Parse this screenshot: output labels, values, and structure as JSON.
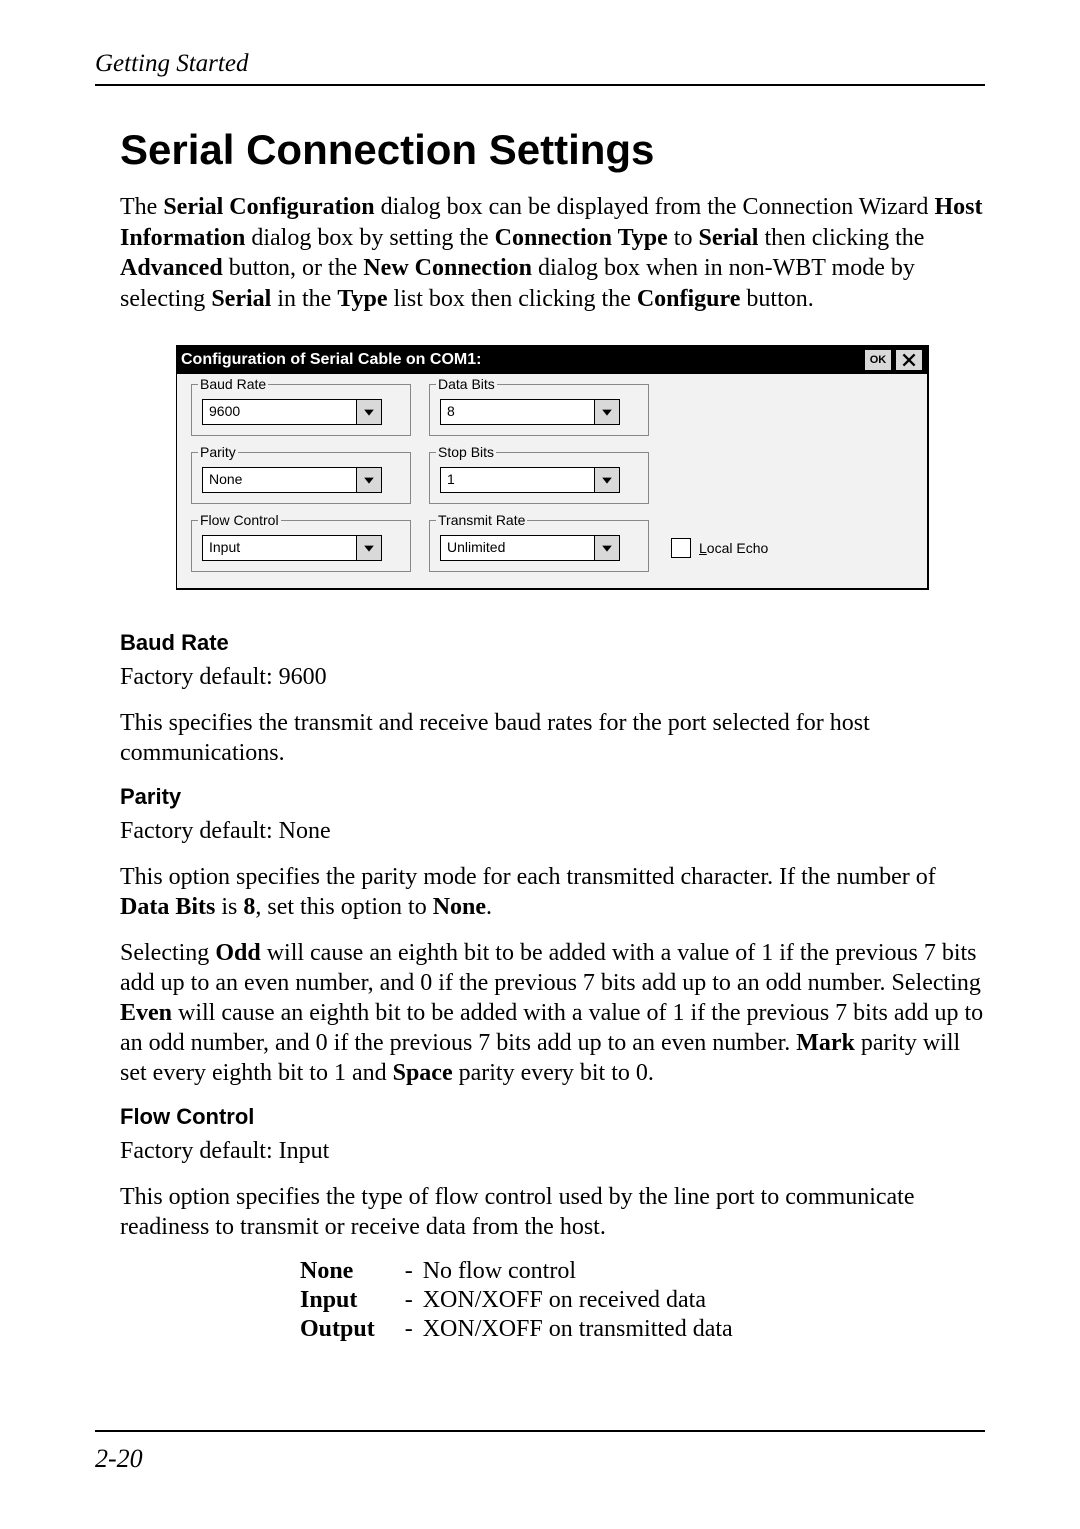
{
  "page": {
    "running_head": "Getting Started",
    "page_number": "2-20",
    "title": "Serial Connection Settings"
  },
  "intro": {
    "p1_a": "The ",
    "p1_b": "Serial Configuration",
    "p1_c": " dialog box can be displayed from the Connection Wizard ",
    "p1_d": "Host Information",
    "p1_e": " dialog box by setting the ",
    "p1_f": "Connection Type",
    "p1_g": " to ",
    "p1_h": "Serial",
    "p1_i": " then clicking the ",
    "p1_j": "Advanced",
    "p1_k": " button, or the ",
    "p1_l": "New Connection",
    "p1_m": " dialog box when in non-WBT mode by selecting ",
    "p1_n": "Serial",
    "p1_o": " in the ",
    "p1_p": "Type",
    "p1_q": " list box then clicking the ",
    "p1_r": "Configure",
    "p1_s": " button."
  },
  "dialog": {
    "title": "Configuration of Serial Cable on COM1:",
    "ok_label": "OK",
    "groups": {
      "baud_rate": {
        "legend": "Baud Rate",
        "value": "9600"
      },
      "data_bits": {
        "legend": "Data Bits",
        "value": "8"
      },
      "parity": {
        "legend": "Parity",
        "value": "None"
      },
      "stop_bits": {
        "legend": "Stop Bits",
        "value": "1"
      },
      "flow_control": {
        "legend": "Flow Control",
        "value": "Input"
      },
      "transmit_rate": {
        "legend": "Transmit Rate",
        "value": "Unlimited"
      }
    },
    "local_echo_label": "Local Echo"
  },
  "defs": {
    "baud_rate": {
      "heading": "Baud Rate",
      "default": "Factory default: 9600",
      "desc": "This specifies the transmit and receive baud rates for the port selected for host communications."
    },
    "parity": {
      "heading": "Parity",
      "default": "Factory default: None",
      "desc1_a": "This option specifies the parity mode for each transmitted character. If the number of ",
      "desc1_b": "Data Bits",
      "desc1_c": " is ",
      "desc1_d": "8",
      "desc1_e": ", set this option to ",
      "desc1_f": "None",
      "desc1_g": ".",
      "desc2_a": "Selecting ",
      "desc2_b": "Odd",
      "desc2_c": " will cause an eighth bit to be added with a value of 1 if the previous 7 bits add up to an even number, and 0 if the previous 7 bits add up to an odd number. Selecting ",
      "desc2_d": "Even",
      "desc2_e": " will cause an eighth bit to be added with a value of 1 if the previous 7 bits add up to an odd number, and 0 if the previous 7 bits add up to an even number. ",
      "desc2_f": "Mark",
      "desc2_g": " parity will set every eighth bit to 1 and ",
      "desc2_h": "Space",
      "desc2_i": " parity every bit to 0."
    },
    "flow_control": {
      "heading": "Flow Control",
      "default": "Factory default: Input",
      "desc": "This option specifies the type of flow control used by the line port to communicate readiness to transmit or receive data from the host.",
      "options": [
        {
          "name": "None",
          "desc": "No flow control"
        },
        {
          "name": "Input",
          "desc": "XON/XOFF on received data"
        },
        {
          "name": "Output",
          "desc": "XON/XOFF on transmitted data"
        }
      ]
    }
  }
}
